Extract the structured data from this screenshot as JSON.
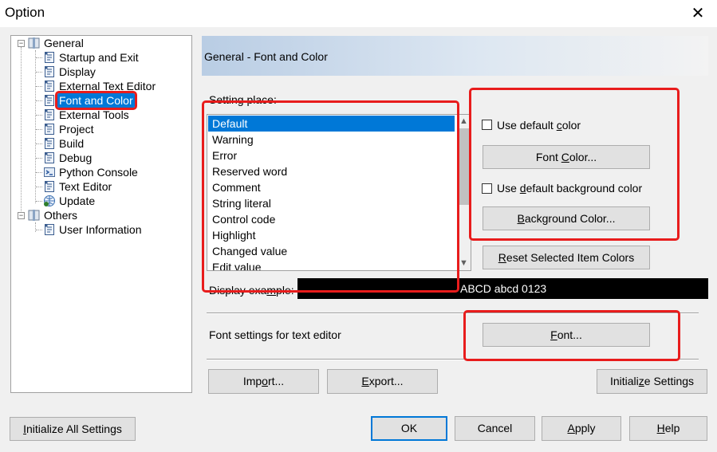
{
  "window": {
    "title": "Option",
    "close_glyph": "✕"
  },
  "tree": {
    "items": [
      {
        "label": "General",
        "icon": "book-icon"
      },
      {
        "label": "Startup and Exit",
        "icon": "page-icon"
      },
      {
        "label": "Display",
        "icon": "page-icon"
      },
      {
        "label": "External Text Editor",
        "icon": "page-icon"
      },
      {
        "label": "Font and Color",
        "icon": "page-icon",
        "selected": true
      },
      {
        "label": "External Tools",
        "icon": "page-icon"
      },
      {
        "label": "Project",
        "icon": "page-icon"
      },
      {
        "label": "Build",
        "icon": "page-icon"
      },
      {
        "label": "Debug",
        "icon": "page-icon"
      },
      {
        "label": "Python Console",
        "icon": "console-icon"
      },
      {
        "label": "Text Editor",
        "icon": "page-icon"
      },
      {
        "label": "Update",
        "icon": "globe-icon"
      },
      {
        "label": "Others",
        "icon": "book-icon"
      },
      {
        "label": "User Information",
        "icon": "page-icon"
      }
    ],
    "collapse_glyph": "−"
  },
  "panel": {
    "header": "General - Font and Color",
    "setting_place_label": "Setting place:",
    "setting_items": [
      "Default",
      "Warning",
      "Error",
      "Reserved word",
      "Comment",
      "String literal",
      "Control code",
      "Highlight",
      "Changed value",
      "Edit value"
    ],
    "selected_item": "Default",
    "scroll_up": "▲",
    "scroll_down": "▼",
    "use_default_color": {
      "pre": "Use default ",
      "accel": "c",
      "post": "olor",
      "checked": false
    },
    "font_color_button": {
      "pre": "Font ",
      "accel": "C",
      "post": "olor..."
    },
    "use_default_bg": {
      "pre": "Use ",
      "accel": "d",
      "post": "efault background color",
      "checked": false
    },
    "background_color_button": {
      "pre": "",
      "accel": "B",
      "post": "ackground Color..."
    },
    "reset_button": {
      "pre": "",
      "accel": "R",
      "post": "eset Selected Item Colors"
    },
    "display_example": {
      "pre": "Display exa",
      "accel": "m",
      "post": "ple:"
    },
    "display_example_text": "ABCD abcd 0123",
    "font_settings_label": "Font settings for text editor",
    "font_button": {
      "pre": "",
      "accel": "F",
      "post": "ont..."
    },
    "import_button": {
      "pre": "Imp",
      "accel": "o",
      "post": "rt..."
    },
    "export_button": {
      "pre": "",
      "accel": "E",
      "post": "xport..."
    },
    "initialize_settings_button": {
      "pre": "Initiali",
      "accel": "z",
      "post": "e Settings"
    }
  },
  "footer": {
    "initialize_all_button": {
      "pre": "",
      "accel": "I",
      "post": "nitialize All Settings"
    },
    "ok": "OK",
    "cancel": "Cancel",
    "apply": {
      "pre": "",
      "accel": "A",
      "post": "pply"
    },
    "help": {
      "pre": "",
      "accel": "H",
      "post": "elp"
    }
  },
  "colors": {
    "selection": "#0078d7",
    "highlight_box": "#e81c1c",
    "header_gradient_start": "#b9cde4",
    "display_bg": "#000000",
    "display_fg": "#ffffff"
  }
}
